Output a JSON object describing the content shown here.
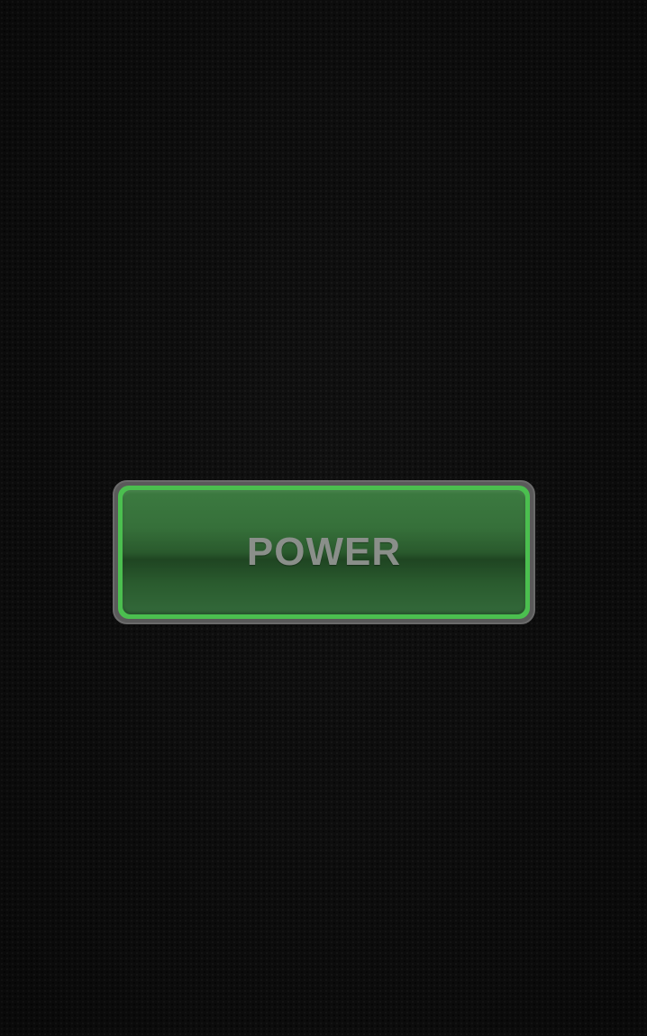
{
  "screen": {
    "background_color": "#0d0d0d"
  },
  "power_button": {
    "label": "POWER",
    "rim_color": "#4bbf4f",
    "face_color": "#2f6533",
    "label_color": "#8a8f8a"
  }
}
